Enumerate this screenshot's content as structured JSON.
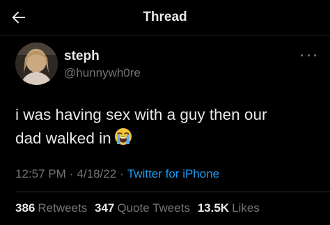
{
  "header": {
    "title": "Thread",
    "back_icon": "arrow-left-icon"
  },
  "tweet": {
    "display_name": "steph",
    "handle": "@hunnywh0re",
    "text": "i was having sex with a guy then our\ndad walked in",
    "emoji": "loudly-crying-face-icon",
    "time": "12:57 PM",
    "date": "4/18/22",
    "source": "Twitter for iPhone",
    "more_icon": "more-horizontal-icon"
  },
  "stats": {
    "retweets": {
      "count": "386",
      "label": "Retweets"
    },
    "quotes": {
      "count": "347",
      "label": "Quote Tweets"
    },
    "likes": {
      "count": "13.5K",
      "label": "Likes"
    }
  },
  "colors": {
    "background": "#000000",
    "text": "#e7e9ea",
    "secondary": "#71767b",
    "link": "#1d9bf0"
  }
}
